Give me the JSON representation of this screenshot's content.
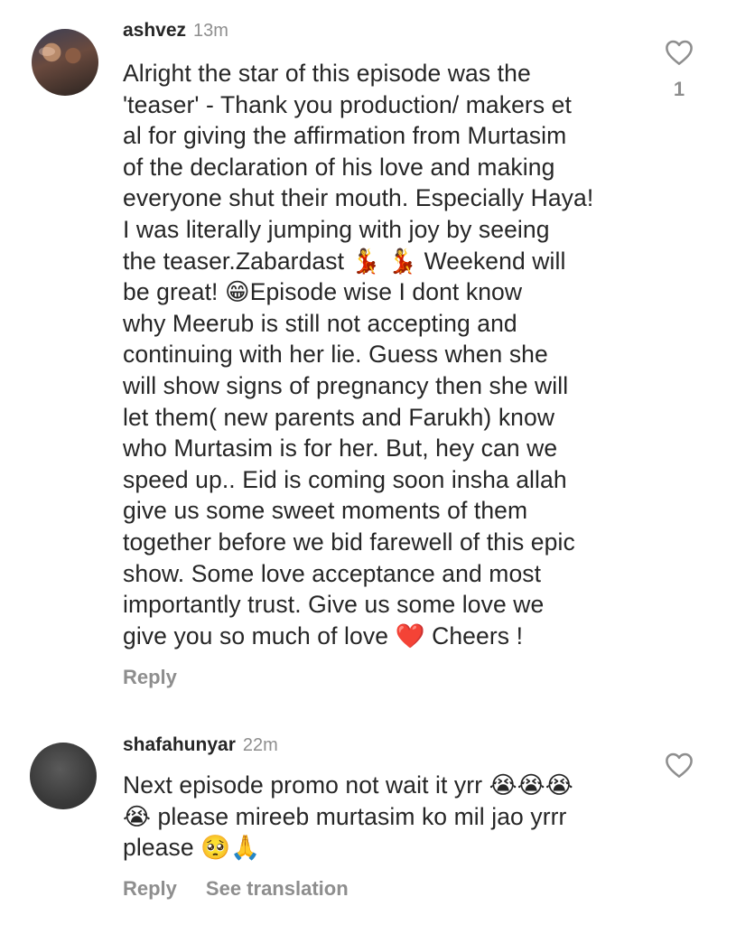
{
  "comments": [
    {
      "username": "ashvez",
      "time": "13m",
      "lines": [
        "Alright the star of this episode was the",
        "'teaser' - Thank you production/ makers et",
        "al for giving the affirmation from Murtasim",
        "of the declaration of his love and making",
        "everyone shut their mouth. Especially Haya!",
        "I was literally jumping with joy by seeing",
        "the teaser.Zabardast 💃 💃 Weekend will",
        "be great! 😁Episode wise I dont know",
        "why Meerub is still not accepting and",
        "continuing with her lie. Guess when she",
        "will show signs of pregnancy then she will",
        "let them( new parents and Farukh) know",
        "who Murtasim is for her. But, hey can we",
        "speed up.. Eid is coming soon insha allah",
        "give us some sweet moments of them",
        "together before we bid farewell of this epic",
        "show. Some love acceptance and most",
        "importantly trust. Give us some love we",
        "give you so much of love ❤️ Cheers !"
      ],
      "reply_label": "Reply",
      "like_count": "1"
    },
    {
      "username": "shafahunyar",
      "time": "22m",
      "lines": [
        "Next episode promo not wait it yrr 😭😭😭",
        "😭 please mireeb murtasim ko mil jao yrrr",
        "please 🥺🙏"
      ],
      "reply_label": "Reply",
      "translation_label": "See translation"
    }
  ],
  "icons": {
    "like": "heart-outline-icon"
  },
  "colors": {
    "text": "#262626",
    "secondary": "#8e8e8e",
    "background": "#ffffff"
  }
}
